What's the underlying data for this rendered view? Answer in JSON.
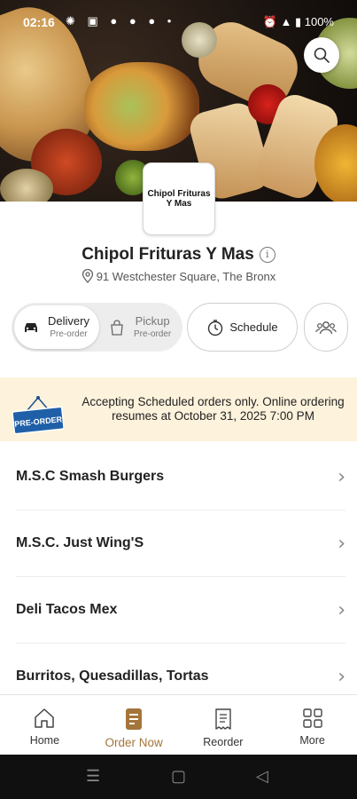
{
  "status_bar": {
    "time": "02:16",
    "left_icons": "✺ ▣ ● ● ● •",
    "right_text": "⏰ ▲ ▮ 100%",
    "battery": "100%"
  },
  "icons": {
    "search": "search-icon",
    "info": "info-icon",
    "location": "location-pin-icon",
    "delivery": "car-icon",
    "pickup": "bag-icon",
    "schedule": "clock-icon",
    "group": "group-icon",
    "chevron": "chevron-right-icon",
    "home": "home-icon",
    "order_now": "order-now-icon",
    "reorder": "receipt-icon",
    "more": "grid-icon"
  },
  "restaurant": {
    "logo_text": "Chipol Frituras Y Mas",
    "name": "Chipol Frituras Y Mas",
    "info_glyph": "i",
    "address": "91 Westchester Square, The Bronx"
  },
  "order_modes": {
    "delivery": {
      "label": "Delivery",
      "sub": "Pre-order",
      "selected": true
    },
    "pickup": {
      "label": "Pickup",
      "sub": "Pre-order",
      "selected": false
    },
    "schedule_label": "Schedule"
  },
  "notice": {
    "sign_text": "PRE-ORDER",
    "message": "Accepting Scheduled orders only. Online ordering resumes at October 31, 2025 7:00 PM",
    "background": "#fdf2dc"
  },
  "menu_categories": [
    {
      "name": "M.S.C Smash Burgers",
      "chevron": "›"
    },
    {
      "name": "M.S.C. Just Wing'S",
      "chevron": "›"
    },
    {
      "name": "Deli Tacos Mex",
      "chevron": "›"
    },
    {
      "name": "Burritos, Quesadillas, Tortas",
      "chevron": "›"
    }
  ],
  "bottom_nav": {
    "home": "Home",
    "order_now": "Order Now",
    "reorder": "Reorder",
    "more": "More",
    "active": "order_now",
    "accent_color": "#a4753a"
  },
  "system_nav": {
    "recents": "☰",
    "home": "▢",
    "back": "◁"
  }
}
